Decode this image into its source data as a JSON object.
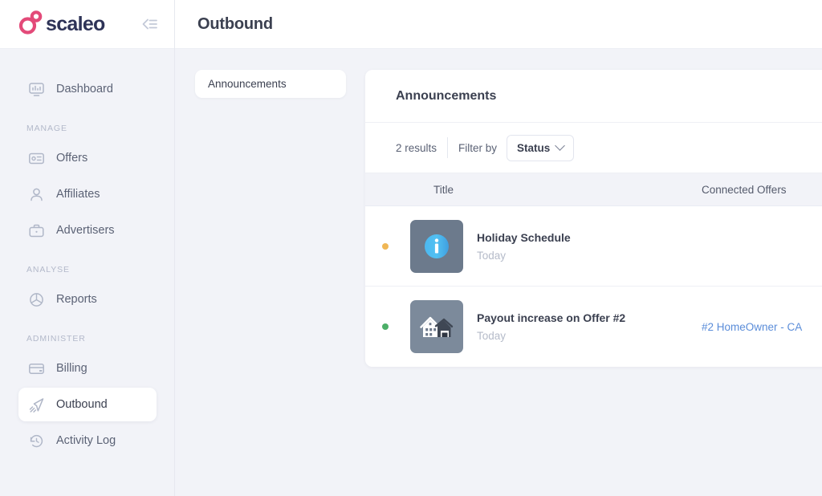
{
  "brand": {
    "name": "scaleo",
    "logo_colors": {
      "mark": "#e34a79",
      "wordmark": "#2e3357"
    },
    "collapse_icon": "collapse-sidebar-icon"
  },
  "sidebar": {
    "background": "#f2f3f8",
    "groups": [
      {
        "label": "",
        "items": [
          {
            "label": "Dashboard",
            "icon": "dashboard-monitor-icon",
            "active": false
          }
        ]
      },
      {
        "label": "MANAGE",
        "items": [
          {
            "label": "Offers",
            "icon": "offers-card-icon",
            "active": false
          },
          {
            "label": "Affiliates",
            "icon": "affiliates-person-icon",
            "active": false
          },
          {
            "label": "Advertisers",
            "icon": "advertisers-briefcase-icon",
            "active": false
          }
        ]
      },
      {
        "label": "ANALYSE",
        "items": [
          {
            "label": "Reports",
            "icon": "reports-piechart-icon",
            "active": false
          }
        ]
      },
      {
        "label": "ADMINISTER",
        "items": [
          {
            "label": "Billing",
            "icon": "billing-creditcard-icon",
            "active": false
          },
          {
            "label": "Outbound",
            "icon": "outbound-paperplane-icon",
            "active": true
          },
          {
            "label": "Activity Log",
            "icon": "activity-log-clock-icon",
            "active": false
          }
        ]
      }
    ]
  },
  "topbar": {
    "title": "Outbound"
  },
  "tabs": [
    {
      "label": "Announcements",
      "active": true
    }
  ],
  "card": {
    "title": "Announcements",
    "toolbar": {
      "results": "2 results",
      "filter_label": "Filter by",
      "filter_value": "Status",
      "chevron_icon": "chevron-down-icon"
    },
    "table": {
      "columns": [
        "Title",
        "Connected Offers"
      ],
      "rows": [
        {
          "status_color": "#f0b755",
          "status_name": "pending",
          "thumb_icon": "info-circle-icon",
          "thumb_bg": "#6c7a8c",
          "title": "Holiday Schedule",
          "subtitle": "Today",
          "connected_offer": ""
        },
        {
          "status_color": "#4caf68",
          "status_name": "active",
          "thumb_icon": "house-icon",
          "thumb_bg": "#7c8a9b",
          "title": "Payout increase on Offer #2",
          "subtitle": "Today",
          "connected_offer": "#2 HomeOwner - CA"
        }
      ]
    }
  }
}
